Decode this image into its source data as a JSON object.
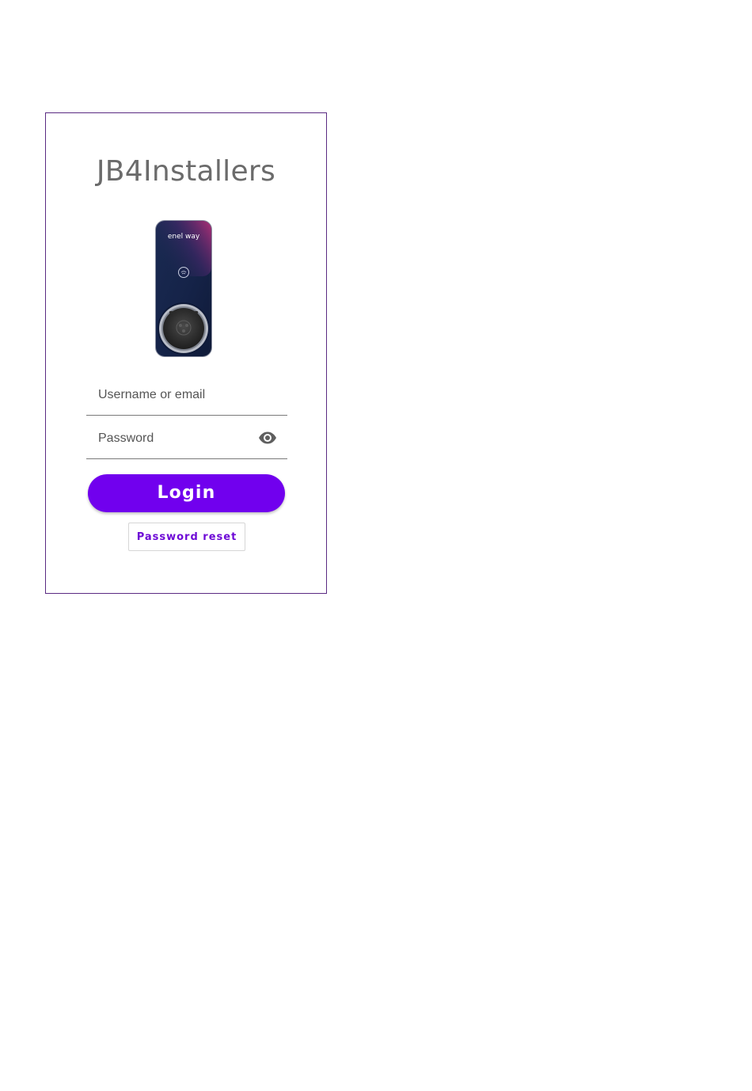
{
  "app": {
    "title": "JB4Installers"
  },
  "device_image": {
    "brand": "enel way"
  },
  "login_form": {
    "username_placeholder": "Username or email",
    "password_placeholder": "Password",
    "show_password_icon": "eye-icon",
    "login_label": "Login",
    "password_reset_label": "Password reset"
  },
  "colors": {
    "frame_border": "#5a2a82",
    "primary_button": "#7100ee",
    "secondary_text": "#6e0ad6",
    "title_text": "#6b6b6b"
  }
}
